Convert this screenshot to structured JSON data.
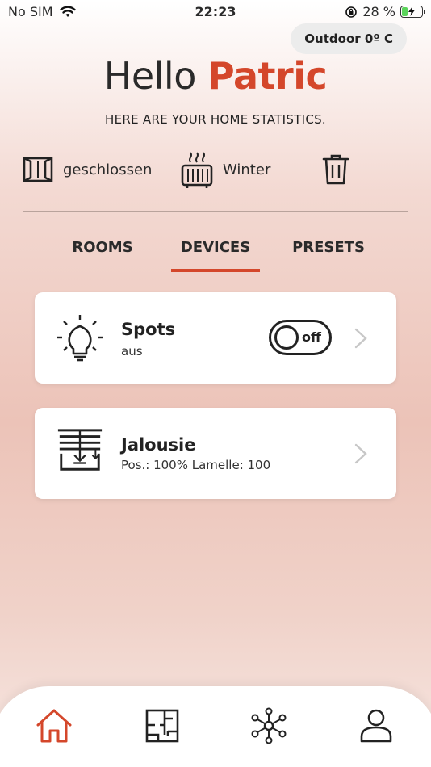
{
  "status_bar": {
    "carrier": "No SIM",
    "time": "22:23",
    "battery_percent": "28 %",
    "battery_level": 0.28
  },
  "outdoor": {
    "label": "Outdoor 0º C"
  },
  "greeting": {
    "hello": "Hello",
    "name": "Patric",
    "subtitle": "HERE ARE YOUR HOME STATISTICS."
  },
  "stats": {
    "window_status": "geschlossen",
    "heating_mode": "Winter"
  },
  "tabs": [
    {
      "label": "ROOMS",
      "active": false
    },
    {
      "label": "DEVICES",
      "active": true
    },
    {
      "label": "PRESETS",
      "active": false
    }
  ],
  "devices": [
    {
      "name": "Spots",
      "status": "aus",
      "toggle": "off",
      "icon": "lightbulb-icon"
    },
    {
      "name": "Jalousie",
      "status": "Pos.: 100% Lamelle: 100",
      "icon": "blinds-icon"
    }
  ],
  "colors": {
    "accent": "#d4472b",
    "text": "#2a2a2a"
  },
  "bottom_nav": [
    "home-icon",
    "floorplan-icon",
    "network-icon",
    "user-icon"
  ]
}
